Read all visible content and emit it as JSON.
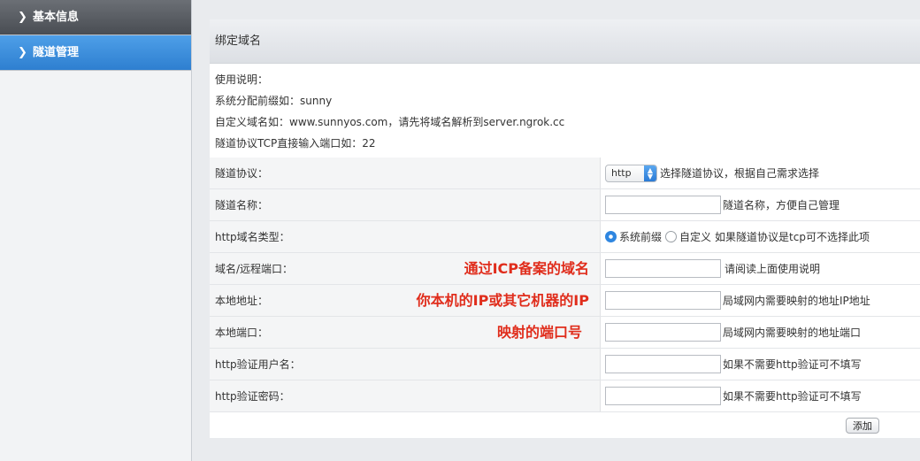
{
  "sidebar": {
    "items": [
      {
        "label": "基本信息"
      },
      {
        "label": "隧道管理"
      }
    ]
  },
  "panel": {
    "title": "绑定域名",
    "notes": [
      "使用说明：",
      "系统分配前缀如：sunny",
      "自定义域名如：www.sunnyos.com，请先将域名解析到server.ngrok.cc",
      "隧道协议TCP直接输入端口如：22"
    ]
  },
  "form": {
    "protocol": {
      "label": "隧道协议：",
      "selected": "http",
      "hint": "选择隧道协议，根据自己需求选择"
    },
    "name": {
      "label": "隧道名称：",
      "value": "",
      "hint": "隧道名称，方便自己管理"
    },
    "domain_type": {
      "label": "http域名类型：",
      "options": [
        "系统前缀",
        "自定义"
      ],
      "selected": "系统前缀",
      "hint": "如果隧道协议是tcp可不选择此项"
    },
    "domain": {
      "label": "域名/远程端口：",
      "value": "",
      "hint": "请阅读上面使用说明",
      "annotation": "通过ICP备案的域名"
    },
    "local_addr": {
      "label": "本地地址：",
      "value": "",
      "hint": "局域网内需要映射的地址IP地址",
      "annotation": "你本机的IP或其它机器的IP"
    },
    "local_port": {
      "label": "本地端口：",
      "value": "",
      "hint": "局域网内需要映射的地址端口",
      "annotation": "映射的端口号"
    },
    "http_user": {
      "label": "http验证用户名：",
      "value": "",
      "hint": "如果不需要http验证可不填写"
    },
    "http_pass": {
      "label": "http验证密码：",
      "value": "",
      "hint": "如果不需要http验证可不填写"
    },
    "submit_label": "添加"
  },
  "colors": {
    "sidebar_active": "#2e7fd0",
    "annotation": "#e02d1c"
  }
}
